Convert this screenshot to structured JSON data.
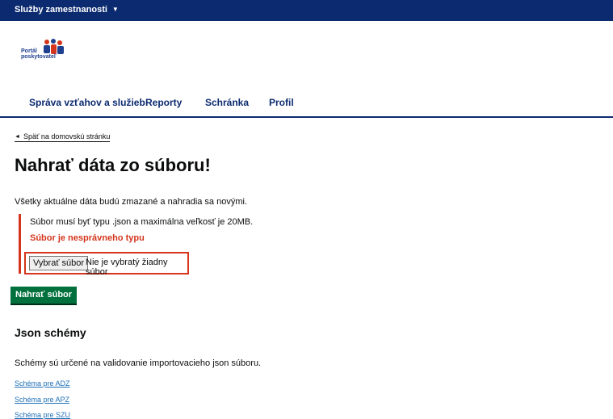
{
  "topbar": {
    "service_menu": "Služby zamestnanosti"
  },
  "logo": {
    "line1": "Portál",
    "line2": "poskytovateľ"
  },
  "nav": [
    "Správa vzťahov a služieb",
    "Reporty",
    "Schránka",
    "Profil"
  ],
  "back_link": "Späť na domovskú stránku",
  "page_title": "Nahrať dáta zo súboru!",
  "intro": "Všetky aktuálne dáta budú zmazané a nahradia sa novými.",
  "upload": {
    "hint": "Súbor musí byť typu .json a maximálna veľkosť je 20MB.",
    "error": "Súbor je nesprávneho typu",
    "choose_button": "Vybrať súbor",
    "no_file_text": "Nie je vybratý žiadny súbor",
    "submit_button": "Nahrať súbor"
  },
  "schemas": {
    "heading": "Json schémy",
    "description": "Schémy sú určené na validovanie importovacieho json súboru.",
    "links": [
      "Schéma pre ADZ",
      "Schéma pre APZ",
      "Schéma pre SZU"
    ]
  },
  "colors": {
    "header_bg": "#0b2a6f",
    "error": "#d4351c",
    "primary_button": "#00703c",
    "link": "#1d70b8"
  }
}
